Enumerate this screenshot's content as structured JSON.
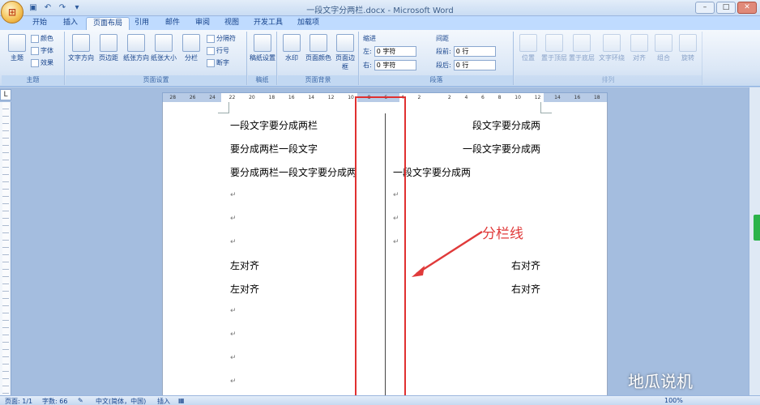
{
  "window": {
    "title": "一段文字分两栏.docx - Microsoft Word",
    "controls": [
      "–",
      "□",
      "✕"
    ]
  },
  "tabs": [
    "开始",
    "插入",
    "页面布局",
    "引用",
    "邮件",
    "审阅",
    "视图",
    "开发工具",
    "加载项"
  ],
  "active_tab": "页面布局",
  "ribbon": {
    "theme": {
      "label": "主题",
      "big": "主题",
      "color": "颜色",
      "font": "字体",
      "effect": "效果"
    },
    "page_setup": {
      "label": "页面设置",
      "text_dir": "文字方向",
      "margins": "页边距",
      "orientation": "纸张方向",
      "size": "纸张大小",
      "columns": "分栏",
      "breaks": "分隔符",
      "line_numbers": "行号",
      "hyphenation": "断字"
    },
    "draft": {
      "label": "稿纸",
      "btn": "稿纸设置"
    },
    "background": {
      "label": "页面背景",
      "watermark": "水印",
      "page_color": "页面颜色",
      "page_border": "页面边框"
    },
    "paragraph": {
      "label": "段落",
      "indent": "缩进",
      "spacing": "间距",
      "left": "左:",
      "right": "右:",
      "before": "段前:",
      "after": "段后:",
      "left_val": "0 字符",
      "right_val": "0 字符",
      "before_val": "0 行",
      "after_val": "0 行"
    },
    "arrange": {
      "label": "排列",
      "position": "位置",
      "front": "置于顶层",
      "back": "置于底层",
      "wrap": "文字环绕",
      "align": "对齐",
      "group": "组合",
      "rotate": "旋转"
    }
  },
  "ruler": {
    "numbers": [
      "28",
      "26",
      "24",
      "22",
      "20",
      "18",
      "16",
      "14",
      "12",
      "10",
      "8",
      "6",
      "4",
      "2",
      "",
      "2",
      "4",
      "6",
      "8",
      "10",
      "12",
      "14",
      "16",
      "18"
    ]
  },
  "document": {
    "left_col": [
      "一段文字要分成两栏",
      "要分成两栏一段文字",
      "要分成两栏一段文字要分成两",
      "左对齐",
      "左对齐"
    ],
    "right_col": [
      "段文字要分成两",
      "一段文字要分成两",
      "一段文字要分成两",
      "右对齐",
      "右对齐"
    ],
    "para_mark": "↵"
  },
  "annotation": "分栏线",
  "watermark": "地瓜说机",
  "status": {
    "page": "页面: 1/1",
    "words": "字数: 66",
    "lang": "中文(简体，中国)",
    "mode": "插入",
    "zoom": "100%"
  }
}
